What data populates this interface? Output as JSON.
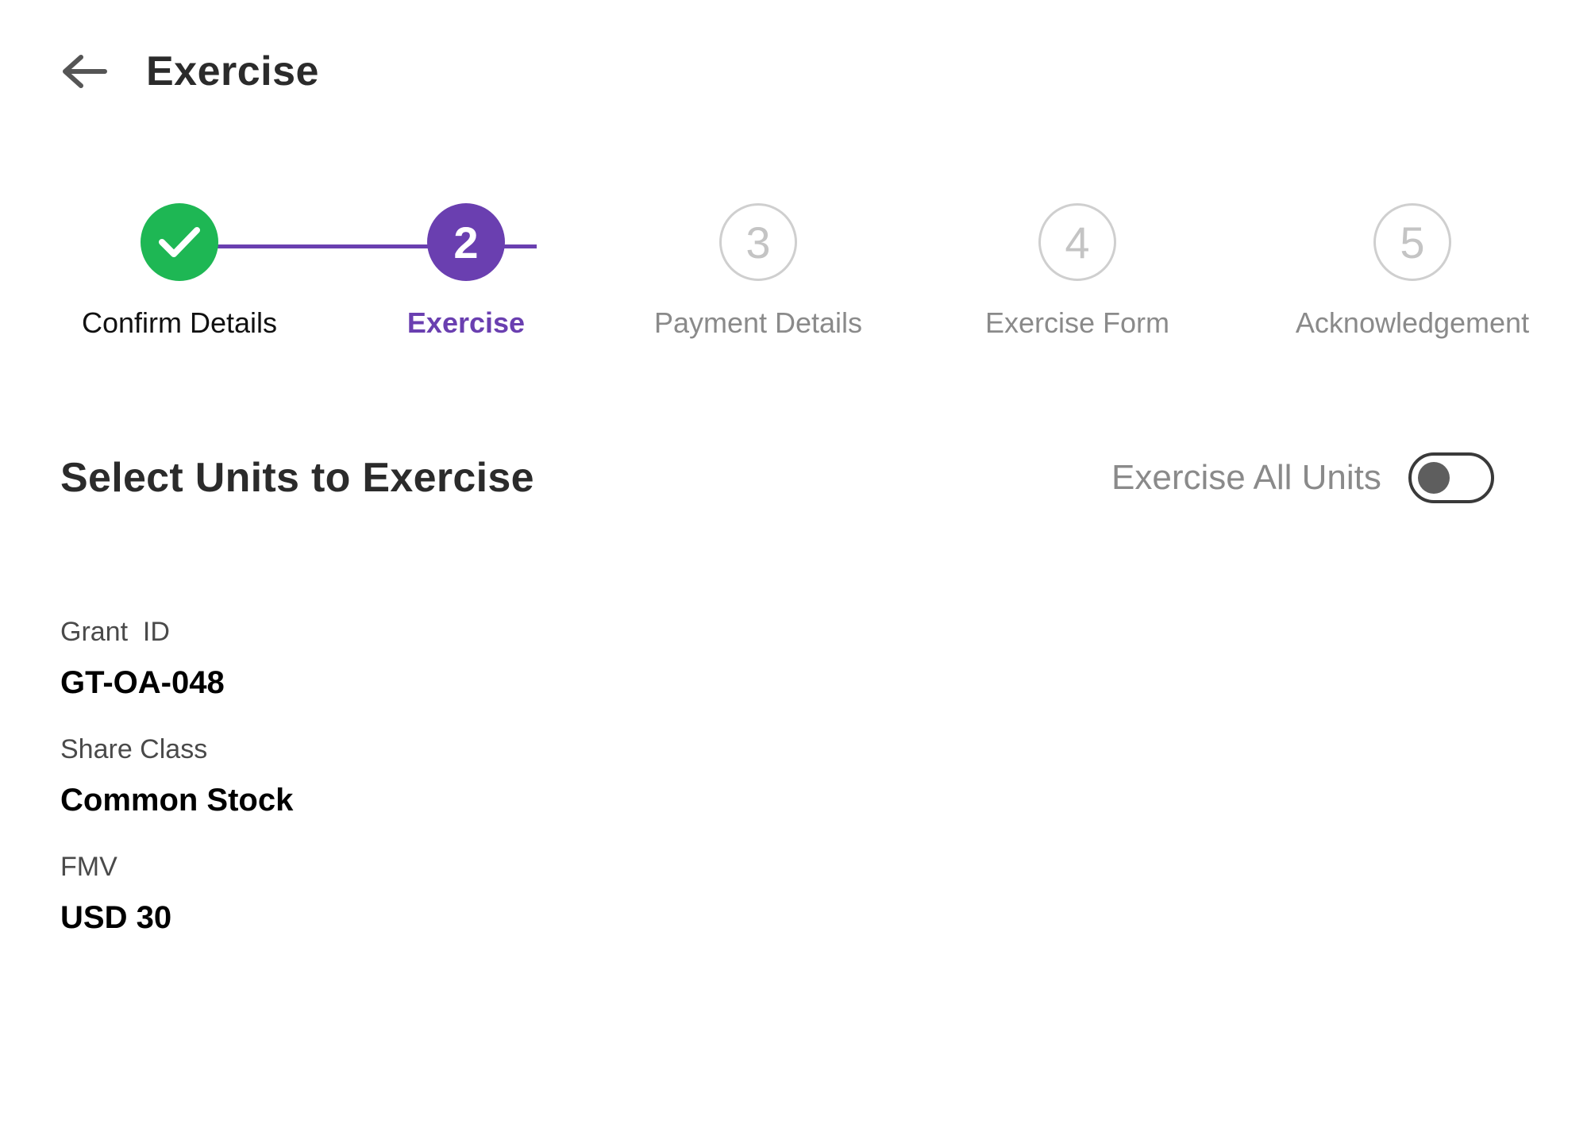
{
  "header": {
    "title": "Exercise",
    "back_icon": "arrow-left-icon"
  },
  "stepper": {
    "steps": [
      {
        "number": "1",
        "label": "Confirm Details",
        "status": "done",
        "icon": "check-icon"
      },
      {
        "number": "2",
        "label": "Exercise",
        "status": "active"
      },
      {
        "number": "3",
        "label": "Payment Details",
        "status": "pending"
      },
      {
        "number": "4",
        "label": "Exercise Form",
        "status": "pending"
      },
      {
        "number": "5",
        "label": "Acknowledgement",
        "status": "pending"
      }
    ],
    "colors": {
      "done": "#1eb754",
      "active": "#6a3fb0",
      "pending": "#cfcfcf"
    }
  },
  "section": {
    "title": "Select Units to Exercise",
    "toggle_label": "Exercise All Units",
    "toggle_on": false
  },
  "fields": [
    {
      "label": "Grant  ID",
      "value": "GT-OA-048"
    },
    {
      "label": "Share Class",
      "value": "Common Stock"
    },
    {
      "label": "FMV",
      "value": "USD 30"
    }
  ]
}
